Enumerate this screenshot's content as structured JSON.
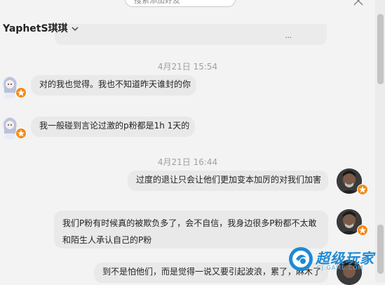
{
  "search": {
    "placeholder": "搜索添加好友"
  },
  "contact": {
    "name": "YaphetS琪琪"
  },
  "messages": [
    {
      "time": "4月21日 15:54"
    },
    {
      "text": "对的我也觉得。我也不知道昨天谁封的你"
    },
    {
      "text": "我一般碰到言论过激的p粉都是1h 1天的"
    },
    {
      "time": "4月21日 16:44"
    },
    {
      "text": "过度的退让只会让他们更加变本加厉的对我们加害"
    },
    {
      "text_line1": "我们P粉有时候真的被欺负多了，会不自信，我身边很多P粉都不太敢",
      "text_line2": "和陌生人承认自己的P粉"
    },
    {
      "text": "到不是怕他们，而是觉得一说又要引起波浪，累了，麻木了"
    }
  ],
  "previous_bubble": {
    "dots": "..."
  },
  "watermark": {
    "brand": "超级玩家",
    "url": "CJ.GAME.COM"
  },
  "colors": {
    "badge": "#f28a1a",
    "watermark": "#1e8ad4",
    "bubble": "#e9e9e9",
    "background": "#f3f3f3"
  },
  "icons": [
    "search-icon",
    "close-icon",
    "chevron-down-icon",
    "star-badge-icon"
  ]
}
